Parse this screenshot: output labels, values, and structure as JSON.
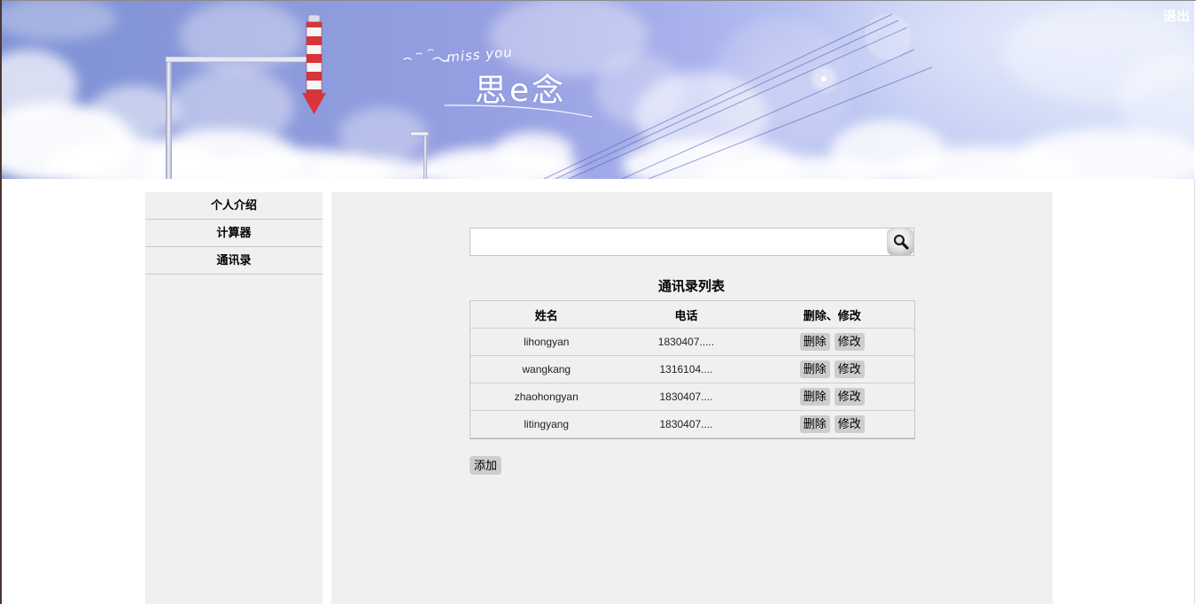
{
  "banner": {
    "logo_tagline": "miss you",
    "logo_title": "思e念",
    "logout_label": "退出"
  },
  "sidebar": {
    "items": [
      {
        "label": "个人介绍"
      },
      {
        "label": "计算器"
      },
      {
        "label": "通讯录"
      }
    ]
  },
  "search": {
    "button_icon": "search-icon"
  },
  "contacts": {
    "title": "通讯录列表",
    "headers": [
      "姓名",
      "电话",
      "删除、修改"
    ],
    "rows": [
      {
        "name": "lihongyan",
        "phone": "1830407.....",
        "delete_label": "删除",
        "edit_label": "修改"
      },
      {
        "name": "wangkang",
        "phone": "1316104....",
        "delete_label": "删除",
        "edit_label": "修改"
      },
      {
        "name": "zhaohongyan",
        "phone": "1830407....",
        "delete_label": "删除",
        "edit_label": "修改"
      },
      {
        "name": "litingyang",
        "phone": "1830407....",
        "delete_label": "删除",
        "edit_label": "修改"
      }
    ],
    "add_label": "添加"
  },
  "colors": {
    "panel_bg": "#f0f0f0",
    "button_bg": "#cdcdcd",
    "banner_text": "#ffffff",
    "sign_red": "#d8343a"
  }
}
